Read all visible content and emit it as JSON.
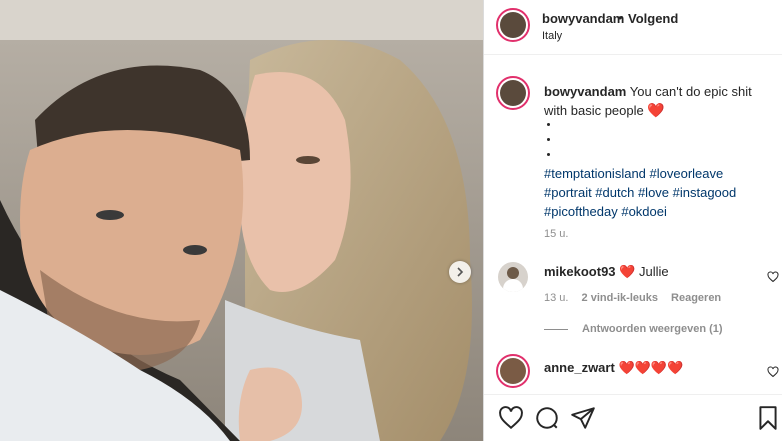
{
  "post": {
    "username": "bowyvandam",
    "separator": "•",
    "follow_label": "Volgend",
    "location": "Italy"
  },
  "caption": {
    "username": "bowyvandam",
    "text": "You can't do epic shit with basic people",
    "emoji": "❤️",
    "hashtags_line1": "#temptationisland #loveorleave",
    "hashtags_line2": "#portrait #dutch #love #instagood",
    "hashtags_line3": "#picoftheday #okdoei",
    "time": "15 u."
  },
  "comments": [
    {
      "username": "mikekoot93",
      "text": "❤️ Jullie",
      "time": "13 u.",
      "likes": "2 vind-ik-leuks",
      "reply_label": "Reageren",
      "view_replies": "Antwoorden weergeven (1)"
    },
    {
      "username": "anne_zwart",
      "text": "❤️❤️❤️❤️"
    }
  ],
  "icons": {
    "like": "heart-icon",
    "comment": "comment-icon",
    "share": "share-icon",
    "save": "bookmark-icon",
    "next": "chevron-right-icon"
  },
  "colors": {
    "hashtag": "#00376b",
    "heart": "#ed4956",
    "muted": "#8e8e8e"
  }
}
